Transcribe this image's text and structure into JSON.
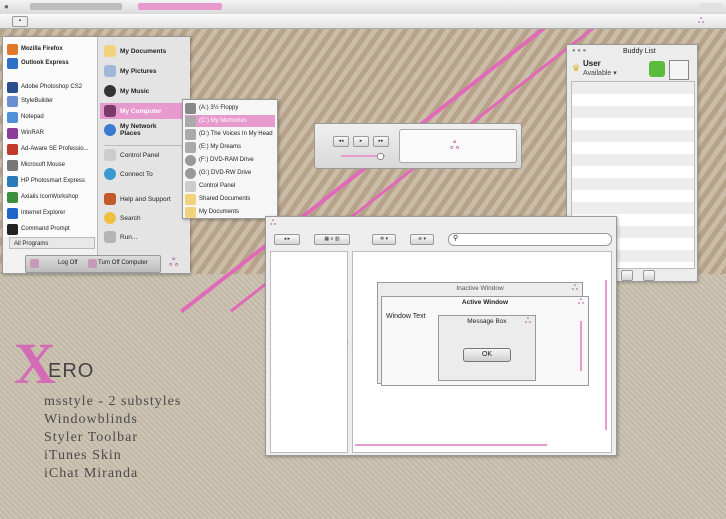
{
  "topbar": {
    "apple_icon": "apple-icon"
  },
  "start_menu": {
    "left_items": [
      {
        "label": "Mozilla Firefox",
        "color": "#e07a2a"
      },
      {
        "label": "Outlook Express",
        "color": "#2e6fc7"
      },
      {
        "label": "Adobe Photoshop CS2",
        "color": "#2b4e8c"
      },
      {
        "label": "StyleBuilder",
        "color": "#6a8fd1"
      },
      {
        "label": "Notepad",
        "color": "#4f8fd9"
      },
      {
        "label": "WinRAR",
        "color": "#8e3b9e"
      },
      {
        "label": "Ad-Aware SE Professio...",
        "color": "#c0392b"
      },
      {
        "label": "Microsoft Mouse",
        "color": "#777777"
      },
      {
        "label": "HP Photosmart Express",
        "color": "#2a7ab8"
      },
      {
        "label": "Axialis IconWorkshop",
        "color": "#3b8e3b"
      },
      {
        "label": "Internet Explorer",
        "color": "#1f64c8"
      },
      {
        "label": "Command Prompt",
        "color": "#222222"
      }
    ],
    "all_programs": "All Programs",
    "right_items": [
      {
        "label": "My Documents"
      },
      {
        "label": "My Pictures"
      },
      {
        "label": "My Music"
      },
      {
        "label": "My Computer"
      },
      {
        "label": "My Network Places"
      },
      {
        "label": "Control Panel"
      },
      {
        "label": "Connect To"
      },
      {
        "label": "Help and Support"
      },
      {
        "label": "Search"
      },
      {
        "label": "Run..."
      }
    ],
    "log_off": "Log Off",
    "turn_off": "Turn Off Computer"
  },
  "submenu": {
    "items": [
      "(A:) 3½ Floppy",
      "(C:) My Memories",
      "(D:) The Voices In My Head",
      "(E:) My Dreams",
      "(F:) DVD-RAM Drive",
      "(G:) DVD-RW Drive",
      "Control Panel",
      "Shared Documents",
      "My Documents"
    ]
  },
  "buddy_list": {
    "title": "Buddy List",
    "user": "User",
    "status": "Available ▾"
  },
  "explorer": {
    "inactive_title": "Inactive Window",
    "active_title": "Active Window",
    "window_text": "Window Text",
    "message_title": "Message Box",
    "ok_label": "OK"
  },
  "branding": {
    "x": "X",
    "ero": "ERO",
    "features": [
      "msstyle - 2 substyles",
      "Windowblinds",
      "Styler Toolbar",
      "iTunes Skin",
      "iChat Miranda"
    ]
  },
  "colors": {
    "accent": "#e06ab8",
    "highlight": "#e79acd"
  }
}
